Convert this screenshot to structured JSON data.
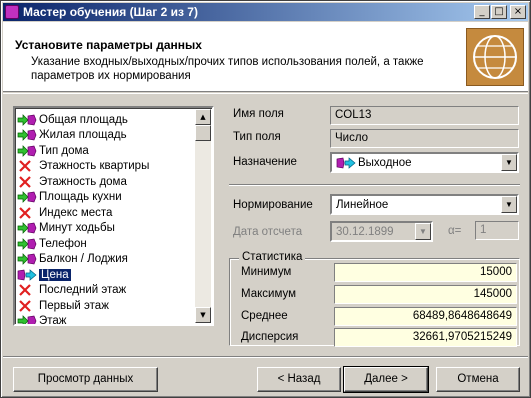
{
  "window": {
    "title": "Мастер обучения (Шаг 2 из 7)",
    "controls": [
      "_",
      "□",
      "×"
    ]
  },
  "header": {
    "title": "Установите параметры данных",
    "subtitle": "Указание входных/выходных/прочих типов использования полей, а также параметров их нормирования"
  },
  "fields_list": [
    {
      "label": "Общая площадь",
      "icon": "input-icon"
    },
    {
      "label": "Жилая площадь",
      "icon": "input-icon"
    },
    {
      "label": "Тип дома",
      "icon": "input-icon"
    },
    {
      "label": "Этажность квартиры",
      "icon": "unused-icon"
    },
    {
      "label": "Этажность дома",
      "icon": "unused-icon"
    },
    {
      "label": "Площадь кухни",
      "icon": "input-icon"
    },
    {
      "label": "Индекс места",
      "icon": "unused-icon"
    },
    {
      "label": "Минут ходьбы",
      "icon": "input-icon"
    },
    {
      "label": "Телефон",
      "icon": "input-icon"
    },
    {
      "label": "Балкон / Лоджия",
      "icon": "input-icon"
    },
    {
      "label": "Цена",
      "icon": "output-icon",
      "selected": true
    },
    {
      "label": "Последний этаж",
      "icon": "unused-icon"
    },
    {
      "label": "Первый этаж",
      "icon": "unused-icon"
    },
    {
      "label": "Этаж",
      "icon": "input-icon"
    }
  ],
  "props": {
    "field_name_label": "Имя поля",
    "field_name_value": "COL13",
    "field_type_label": "Тип поля",
    "field_type_value": "Число",
    "purpose_label": "Назначение",
    "purpose_value": "Выходное",
    "norm_label": "Нормирование",
    "norm_value": "Линейное",
    "date_label": "Дата отсчета",
    "date_value": "30.12.1899",
    "alpha_label": "α=",
    "alpha_value": "1"
  },
  "stats": {
    "title": "Статистика",
    "rows": [
      {
        "label": "Минимум",
        "value": "15000"
      },
      {
        "label": "Максимум",
        "value": "145000"
      },
      {
        "label": "Среднее",
        "value": "68489,8648648649"
      },
      {
        "label": "Дисперсия",
        "value": "32661,9705215249"
      }
    ]
  },
  "buttons": {
    "preview": "Просмотр данных",
    "back": "< Назад",
    "next": "Далее >",
    "cancel": "Отмена"
  },
  "colors": {
    "title_start": "#0a246a",
    "title_end": "#a6caf0",
    "stat_bg": "#ffffe1",
    "selection": "#0a246a"
  }
}
